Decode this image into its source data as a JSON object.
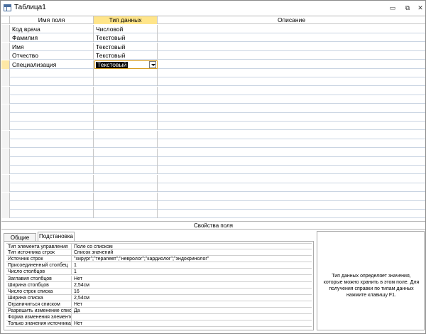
{
  "window": {
    "title": "Таблица1",
    "buttons": {
      "minimize": "▭",
      "restore": "⧉",
      "close": "✕"
    }
  },
  "columns": {
    "name": "Имя поля",
    "type": "Тип данных",
    "description": "Описание"
  },
  "fields": [
    {
      "name": "Код врача",
      "type": "Числовой"
    },
    {
      "name": "Фамилия",
      "type": "Текстовый"
    },
    {
      "name": "Имя",
      "type": "Текстовый"
    },
    {
      "name": "Отчество",
      "type": "Текстовый"
    },
    {
      "name": "Специализация",
      "type": "Текстовый"
    }
  ],
  "active_field_index": 4,
  "properties_title": "Свойства поля",
  "tabs": {
    "general": "Общие",
    "lookup": "Подстановка"
  },
  "lookup_properties": [
    {
      "label": "Тип элемента управления",
      "value": "Поле со списком"
    },
    {
      "label": "Тип источника строк",
      "value": "Список значений"
    },
    {
      "label": "Источник строк",
      "value": "\"хирург\";\"терапевт\";\"невролог\";\"кардиолог\";\"эндокринолог\""
    },
    {
      "label": "Присоединенный столбец",
      "value": "1"
    },
    {
      "label": "Число столбцов",
      "value": "1"
    },
    {
      "label": "Заглавия столбцов",
      "value": "Нет"
    },
    {
      "label": "Ширина столбцов",
      "value": "2,54см"
    },
    {
      "label": "Число строк списка",
      "value": "16"
    },
    {
      "label": "Ширина списка",
      "value": "2,54см"
    },
    {
      "label": "Ограничиться списком",
      "value": "Нет"
    },
    {
      "label": "Разрешить изменение списка",
      "value": "Да"
    },
    {
      "label": "Форма изменения элементов списка",
      "value": ""
    },
    {
      "label": "Только значения источника строк",
      "value": "Нет"
    }
  ],
  "help_text": "Тип данных определяет значения, которые можно хранить в этом поле. Для получения справки по типам данных нажмите клавишу F1.",
  "colors": {
    "active_header": "#ffe58a",
    "active_row_selector": "#fde8a6",
    "editor_border": "#d79c1e"
  }
}
